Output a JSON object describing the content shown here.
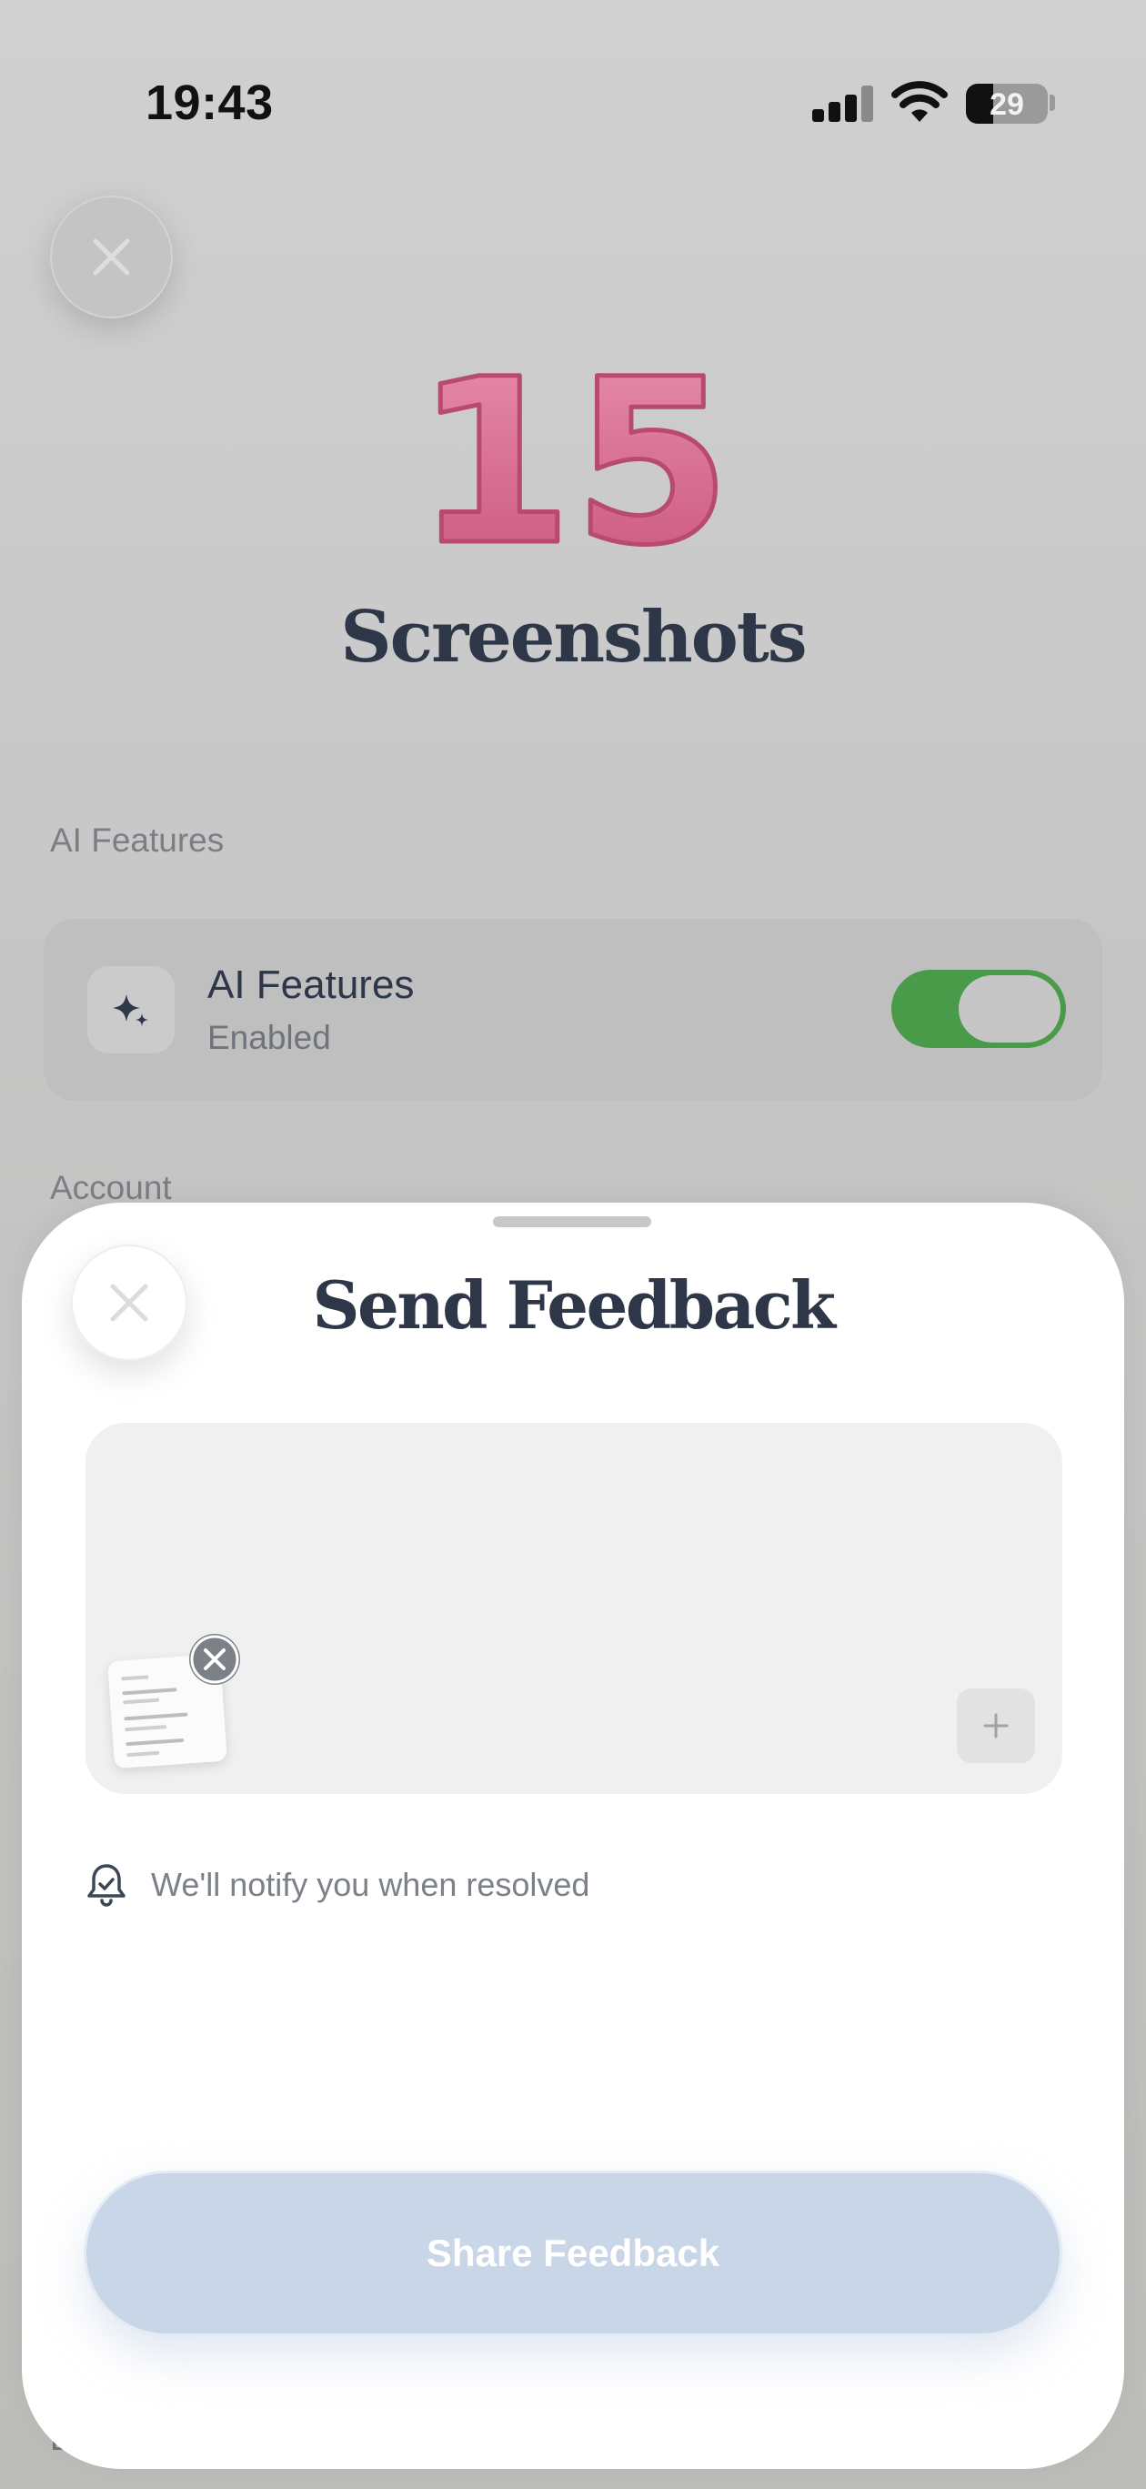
{
  "status_bar": {
    "time": "19:43",
    "battery_level": "29",
    "signal_bars_filled": 3,
    "signal_bars_total": 4
  },
  "background_page": {
    "close_icon": "close-icon",
    "hero_badge": "15",
    "hero_badge_color": "#d9708f",
    "app_title": "Screenshots",
    "ai_section_label": "AI Features",
    "ai_card": {
      "icon": "sparkles-icon",
      "title": "AI Features",
      "subtitle": "Enabled",
      "toggle_on": true,
      "toggle_color": "#4a9b49"
    },
    "account_section_label": "Account",
    "next_section_label_peek": "Da"
  },
  "sheet": {
    "title": "Send Feedback",
    "close_icon": "close-icon",
    "feedback_input": {
      "value": "",
      "placeholder": ""
    },
    "attachment": {
      "thumbnail": "screenshot-thumbnail",
      "remove_icon": "close-circle-icon"
    },
    "add_attachment_icon": "plus-icon",
    "notify": {
      "icon": "bell-icon",
      "text": "We'll notify you when resolved"
    },
    "share_button": {
      "label": "Share Feedback",
      "enabled": false,
      "color": "#c9d6e8"
    }
  }
}
